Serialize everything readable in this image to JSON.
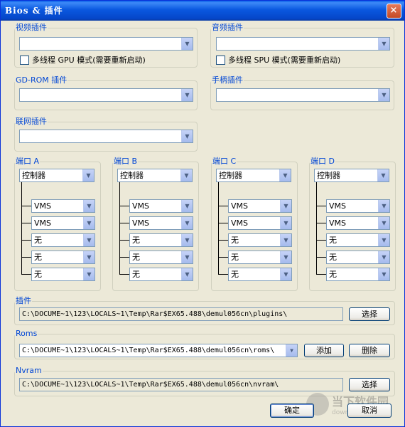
{
  "window": {
    "title": "Bios & 插件",
    "close_glyph": "×"
  },
  "video": {
    "title": "视频插件",
    "value": "",
    "multithread_label": "多线程 GPU 模式(需要重新启动)"
  },
  "audio": {
    "title": "音频插件",
    "value": "",
    "multithread_label": "多线程 SPU 模式(需要重新启动)"
  },
  "gdrom": {
    "title": "GD-ROM 插件",
    "value": ""
  },
  "joystick": {
    "title": "手柄插件",
    "value": ""
  },
  "network": {
    "title": "联网插件",
    "value": ""
  },
  "ports": [
    {
      "title": "端口 A",
      "device": "控制器",
      "slots": [
        "VMS",
        "VMS",
        "无",
        "无",
        "无"
      ]
    },
    {
      "title": "端口 B",
      "device": "控制器",
      "slots": [
        "VMS",
        "VMS",
        "无",
        "无",
        "无"
      ]
    },
    {
      "title": "端口 C",
      "device": "控制器",
      "slots": [
        "VMS",
        "VMS",
        "无",
        "无",
        "无"
      ]
    },
    {
      "title": "端口 D",
      "device": "控制器",
      "slots": [
        "VMS",
        "VMS",
        "无",
        "无",
        "无"
      ]
    }
  ],
  "plugins_path": {
    "title": "插件",
    "path": "C:\\DOCUME~1\\123\\LOCALS~1\\Temp\\Rar$EX65.488\\demul056cn\\plugins\\",
    "select_label": "选择"
  },
  "roms": {
    "title": "Roms",
    "path": "C:\\DOCUME~1\\123\\LOCALS~1\\Temp\\Rar$EX65.488\\demul056cn\\roms\\",
    "add_label": "添加",
    "delete_label": "删除"
  },
  "nvram": {
    "title": "Nvram",
    "path": "C:\\DOCUME~1\\123\\LOCALS~1\\Temp\\Rar$EX65.488\\demul056cn\\nvram\\",
    "select_label": "选择"
  },
  "footer": {
    "ok_label": "确定",
    "cancel_label": "取消"
  },
  "watermark": {
    "text": "当下软件园",
    "sub": "downxia.com"
  }
}
